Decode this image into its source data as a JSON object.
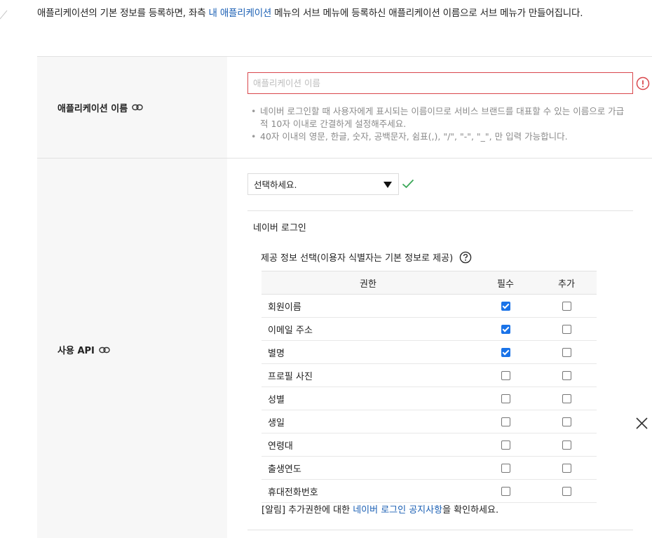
{
  "intro": {
    "text_before": "애플리케이션의 기본 정보를 등록하면, 좌측 ",
    "link": "내 애플리케이션",
    "text_after": " 메뉴의 서브 메뉴에 등록하신 애플리케이션 이름으로 서브 메뉴가 만들어집니다."
  },
  "app_name": {
    "label": "애플리케이션 이름",
    "value": "",
    "placeholder": "애플리케이션 이름",
    "hints": [
      "네이버 로그인할 때 사용자에게 표시되는 이름이므로 서비스 브랜드를 대표할 수 있는 이름으로 가급적 10자 이내로 간결하게 설정해주세요.",
      "40자 이내의 영문, 한글, 숫자, 공백문자, 쉼표(,), \"/\", \"-\", \"_\", 만 입력 가능합니다."
    ]
  },
  "api": {
    "label": "사용 API",
    "select_value": "선택하세요.",
    "panel_title": "네이버 로그인",
    "info_title": "제공 정보 선택(이용자 식별자는 기본 정보로 제공)",
    "columns": {
      "name": "권한",
      "required": "필수",
      "extra": "추가"
    },
    "permissions": [
      {
        "name": "회원이름",
        "required": true,
        "extra": false
      },
      {
        "name": "이메일 주소",
        "required": true,
        "extra": false
      },
      {
        "name": "별명",
        "required": true,
        "extra": false
      },
      {
        "name": "프로필 사진",
        "required": false,
        "extra": false
      },
      {
        "name": "성별",
        "required": false,
        "extra": false
      },
      {
        "name": "생일",
        "required": false,
        "extra": false
      },
      {
        "name": "연령대",
        "required": false,
        "extra": false
      },
      {
        "name": "출생연도",
        "required": false,
        "extra": false
      },
      {
        "name": "휴대전화번호",
        "required": false,
        "extra": false
      }
    ],
    "notice": {
      "prefix": "[알림] 추가권한에 대한 ",
      "link": "네이버 로그인 공지사항",
      "suffix": "을 확인하세요."
    }
  },
  "colors": {
    "accent": "#1a73e8",
    "link": "#1a5fb4",
    "error": "#d9474c",
    "ok": "#3aa757"
  },
  "icons": {
    "link": "chain-link-icon",
    "warning": "warning-circle-icon",
    "check": "check-icon",
    "help": "question-circle-icon",
    "close": "close-icon"
  }
}
